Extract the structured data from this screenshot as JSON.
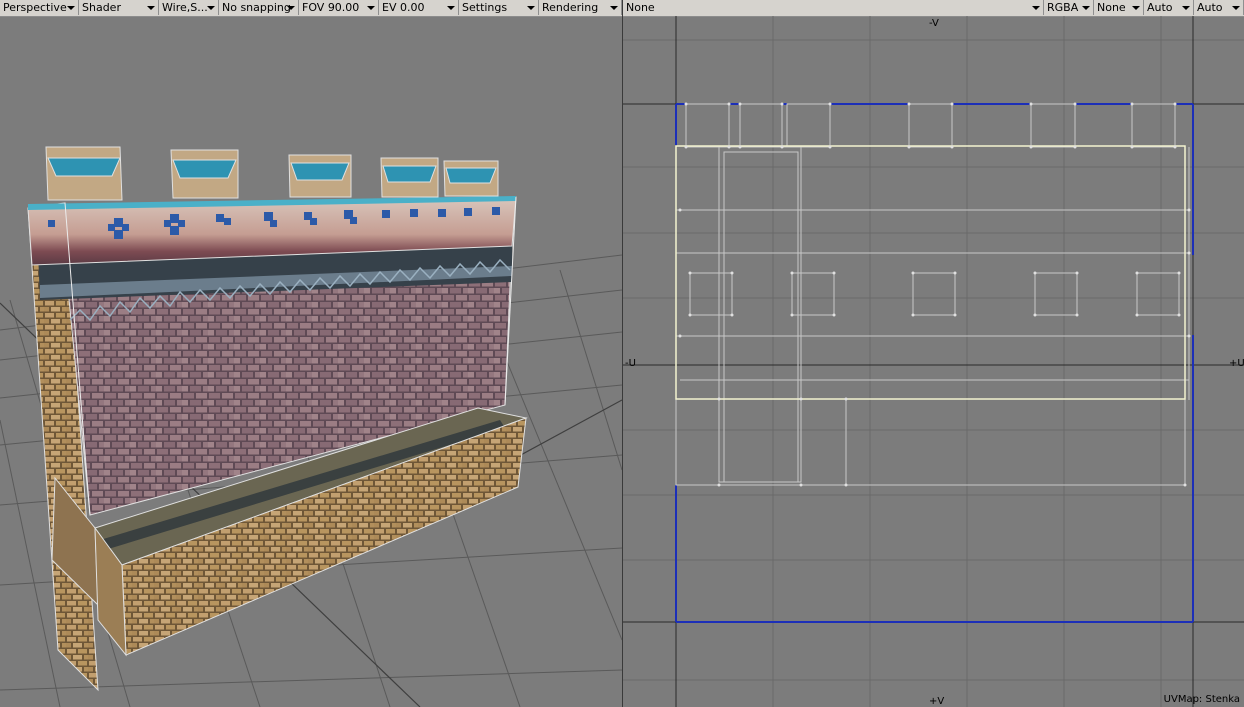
{
  "left_viewport": {
    "toolbar": {
      "view_mode": "Perspective",
      "shading": "Shader",
      "display": "Wire,S...",
      "snapping": "No snapping",
      "fov": "FOV 90.00",
      "ev": "EV  0.00",
      "settings": "Settings",
      "rendering": "Rendering"
    }
  },
  "right_viewport": {
    "toolbar": {
      "uv_source": "None",
      "channel": "RGBA",
      "background": "None",
      "zoom_u": "Auto",
      "zoom_v": "Auto"
    },
    "axes": {
      "neg_v": "-V",
      "pos_v": "+V",
      "neg_u": "-U",
      "pos_u": "+U"
    },
    "uvmap_label": "UVMap: Stenka"
  },
  "colors": {
    "viewport_bg": "#7c7c7c",
    "uv_boundary": "#1c2fb8",
    "uv_selected": "#f3f3d0",
    "uv_wire": "#c8c8c8"
  }
}
